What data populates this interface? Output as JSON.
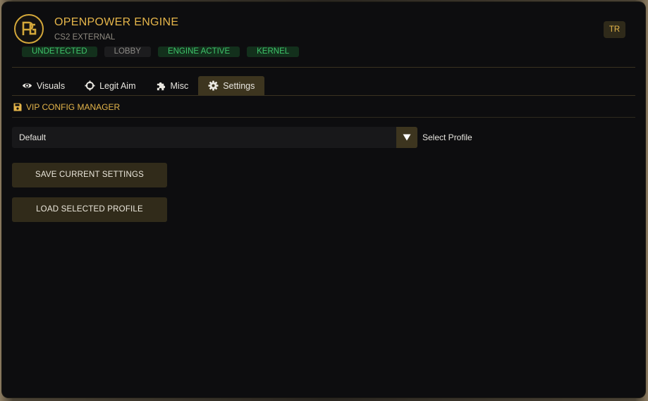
{
  "app": {
    "title": "OPENPOWER ENGINE",
    "subtitle": "CS2 EXTERNAL",
    "language_button": "TR",
    "accent_color": "#e5b54a"
  },
  "badges": [
    {
      "label": "UNDETECTED",
      "status": "green"
    },
    {
      "label": "LOBBY",
      "status": "gray"
    },
    {
      "label": "ENGINE ACTIVE",
      "status": "green"
    },
    {
      "label": "KERNEL",
      "status": "green"
    }
  ],
  "tabs": [
    {
      "label": "Visuals",
      "icon": "eye-icon",
      "active": false
    },
    {
      "label": "Legit Aim",
      "icon": "crosshair-icon",
      "active": false
    },
    {
      "label": "Misc",
      "icon": "puzzle-icon",
      "active": false
    },
    {
      "label": "Settings",
      "icon": "gear-icon",
      "active": true
    }
  ],
  "config_manager": {
    "section_title": "VIP CONFIG MANAGER",
    "section_icon": "save-icon",
    "profile_select": {
      "value": "Default",
      "label": "Select Profile"
    },
    "save_button": "SAVE CURRENT SETTINGS",
    "load_button": "LOAD SELECTED PROFILE"
  }
}
